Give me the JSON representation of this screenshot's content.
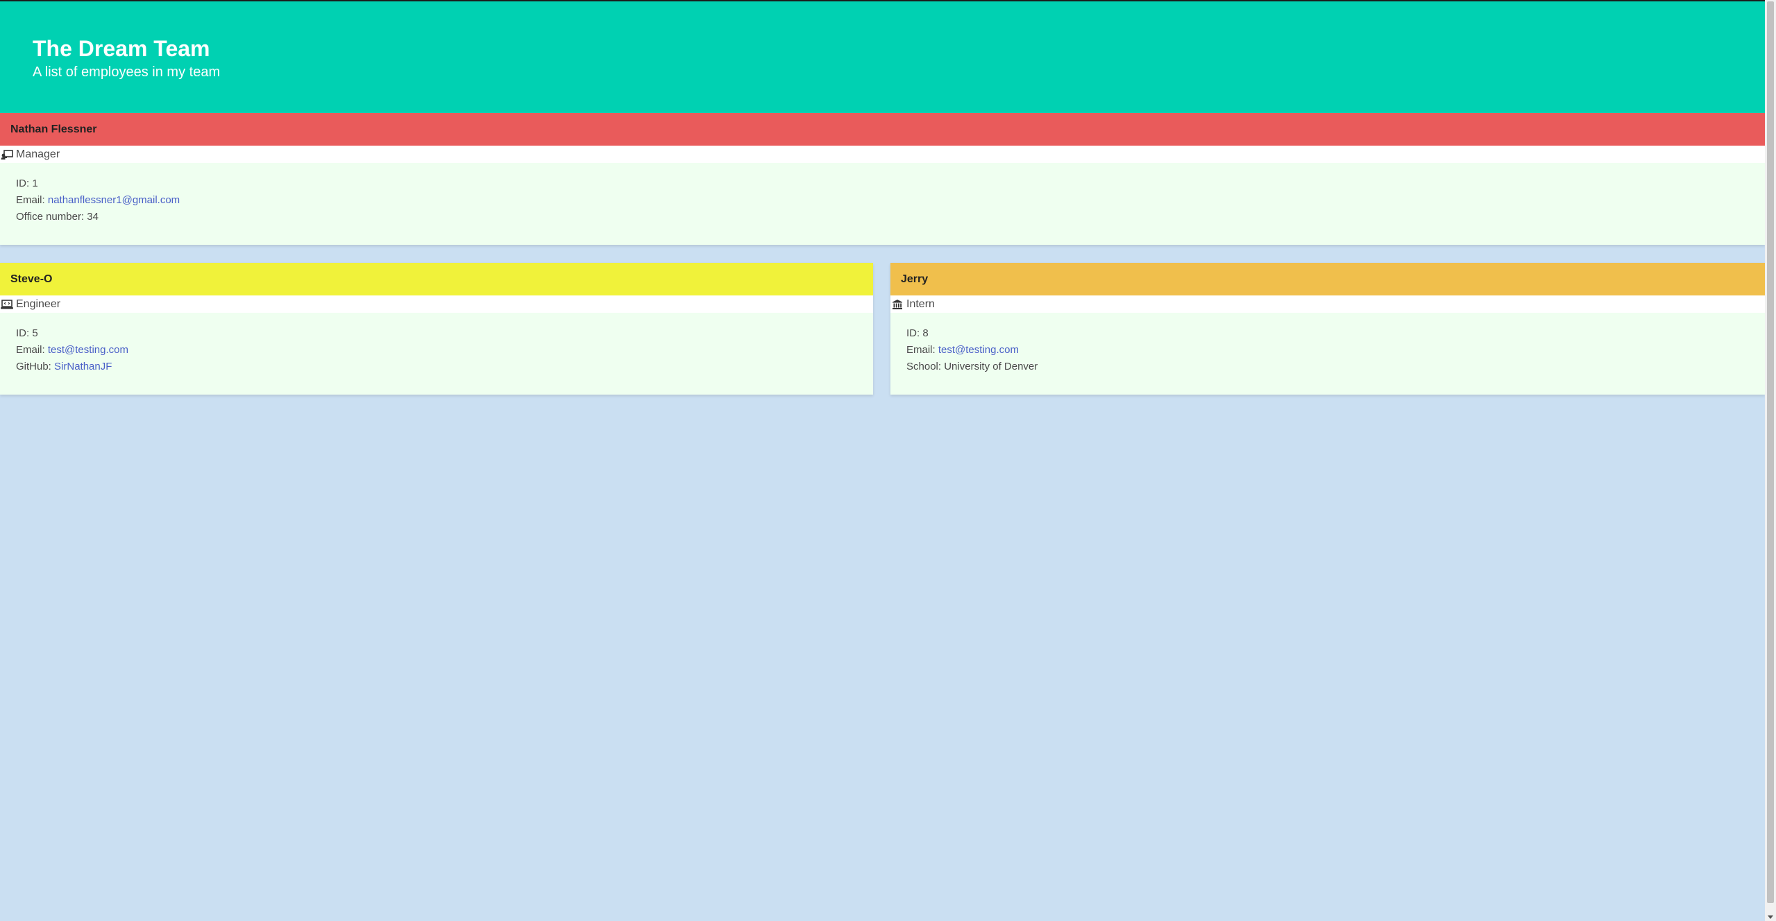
{
  "hero": {
    "title": "The Dream Team",
    "subtitle": "A list of employees in my team",
    "color": "#00d1b2"
  },
  "manager": {
    "name": "Nathan Flessner",
    "role": "Manager",
    "role_icon": "chalkboard-teacher-icon",
    "header_color": "#e95b5b",
    "id_label": "ID:",
    "id": "1",
    "email_label": "Email:",
    "email": "nathanflessner1@gmail.com",
    "office_label": "Office number:",
    "office": "34"
  },
  "engineer": {
    "name": "Steve-O",
    "role": "Engineer",
    "role_icon": "laptop-code-icon",
    "header_color": "#f0f23a",
    "id_label": "ID:",
    "id": "5",
    "email_label": "Email:",
    "email": "test@testing.com",
    "github_label": "GitHub:",
    "github": "SirNathanJF"
  },
  "intern": {
    "name": "Jerry",
    "role": "Intern",
    "role_icon": "university-icon",
    "header_color": "#f0bf4c",
    "id_label": "ID:",
    "id": "8",
    "email_label": "Email:",
    "email": "test@testing.com",
    "school_label": "School:",
    "school": "University of Denver"
  },
  "colors": {
    "background": "#cadff2",
    "card_body": "#effff0",
    "link": "#485fc7"
  }
}
